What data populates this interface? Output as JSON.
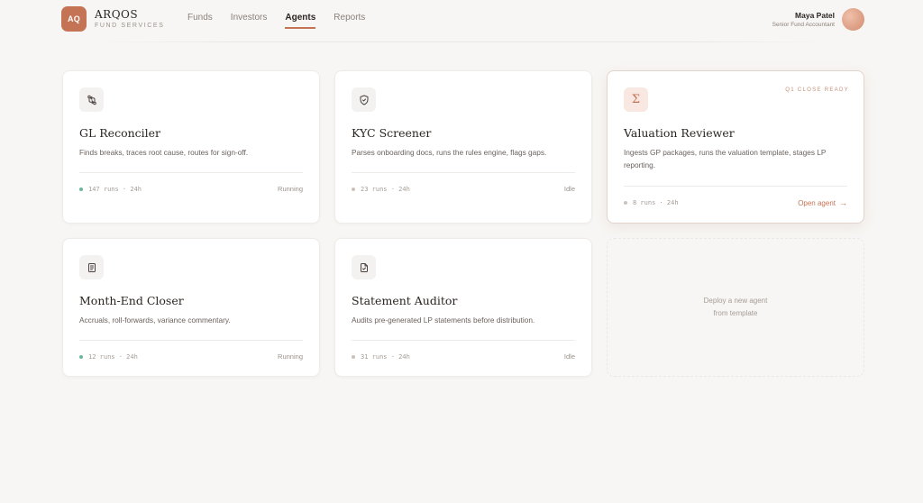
{
  "brand": {
    "badge": "AQ",
    "name": "ARQOS",
    "subtitle": "FUND SERVICES"
  },
  "nav": [
    {
      "label": "Funds",
      "active": false
    },
    {
      "label": "Investors",
      "active": false
    },
    {
      "label": "Agents",
      "active": true
    },
    {
      "label": "Reports",
      "active": false
    }
  ],
  "user": {
    "name": "Maya Patel",
    "role": "Senior Fund Accountant"
  },
  "agents": [
    {
      "icon": "git-compare-icon",
      "title": "GL Reconciler",
      "description": "Finds breaks, traces root cause, routes for sign-off.",
      "stats": "147 runs · 24h",
      "status": "Running"
    },
    {
      "icon": "shield-check-icon",
      "title": "KYC Screener",
      "description": "Parses onboarding docs, runs the rules engine, flags gaps.",
      "stats": "23 runs · 24h",
      "status": "Idle"
    },
    {
      "icon": "sigma-icon",
      "title": "Valuation Reviewer",
      "description": "Ingests GP packages, runs the valuation template, stages LP reporting.",
      "stats": "8 runs · 24h",
      "badge": "Q1 CLOSE READY",
      "action": "Open agent"
    },
    {
      "icon": "book-icon",
      "title": "Month-End Closer",
      "description": "Accruals, roll-forwards, variance commentary.",
      "stats": "12 runs · 24h",
      "status": "Running"
    },
    {
      "icon": "document-check-icon",
      "title": "Statement Auditor",
      "description": "Audits pre-generated LP statements before distribution.",
      "stats": "31 runs · 24h",
      "status": "Idle"
    }
  ],
  "deploy": {
    "line1": "Deploy a new agent",
    "line2": "from template"
  },
  "colors": {
    "accent": "#c47455",
    "running": "#6ab89a",
    "idle": "#c9c2bd",
    "background": "#f8f6f4"
  }
}
